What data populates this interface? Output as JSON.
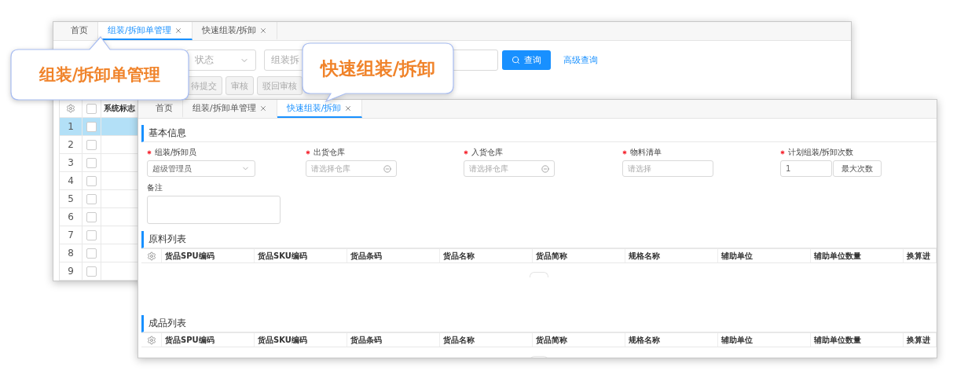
{
  "back_window": {
    "tabs": [
      {
        "label": "首页",
        "closable": false,
        "selected": false
      },
      {
        "label": "组装/拆卸单管理",
        "closable": true,
        "selected": true
      },
      {
        "label": "快速组装/拆卸",
        "closable": true,
        "selected": false
      }
    ],
    "filters": {
      "status_select": {
        "placeholder": "状态"
      },
      "code_input": {
        "placeholder": "组装拆"
      },
      "search_button": "查询",
      "advanced_link": "高级查询"
    },
    "actions": [
      {
        "label": "待提交",
        "disabled": true
      },
      {
        "label": "审核",
        "disabled": true
      },
      {
        "label": "驳回审核",
        "disabled": true
      }
    ],
    "table": {
      "columns": [
        "系统标志"
      ],
      "header_checked": false,
      "rows": [
        {
          "index": "1",
          "selected": true,
          "checked": false
        },
        {
          "index": "2",
          "selected": false,
          "checked": false
        },
        {
          "index": "3",
          "selected": false,
          "checked": false
        },
        {
          "index": "4",
          "selected": false,
          "checked": false
        },
        {
          "index": "5",
          "selected": false,
          "checked": false
        },
        {
          "index": "6",
          "selected": false,
          "checked": false
        },
        {
          "index": "7",
          "selected": false,
          "checked": false
        },
        {
          "index": "8",
          "selected": false,
          "checked": false
        },
        {
          "index": "9",
          "selected": false,
          "checked": false
        }
      ]
    }
  },
  "front_window": {
    "tabs": [
      {
        "label": "首页",
        "closable": false,
        "selected": false
      },
      {
        "label": "组装/拆卸单管理",
        "closable": true,
        "selected": false
      },
      {
        "label": "快速组装/拆卸",
        "closable": true,
        "selected": true
      }
    ],
    "basic_info": {
      "title": "基本信息",
      "fields": [
        {
          "label": "组装/拆卸员",
          "required": true,
          "kind": "select",
          "value": "超级管理员"
        },
        {
          "label": "出货仓库",
          "required": true,
          "kind": "picker",
          "placeholder": "请选择仓库"
        },
        {
          "label": "入货仓库",
          "required": true,
          "kind": "picker",
          "placeholder": "请选择仓库"
        },
        {
          "label": "物料清单",
          "required": true,
          "kind": "input",
          "placeholder": "请选择"
        },
        {
          "label": "计划组装/拆卸次数",
          "required": true,
          "kind": "number",
          "value": "1",
          "button": "最大次数"
        }
      ],
      "remarks": {
        "label": "备注"
      }
    },
    "tables": [
      {
        "title": "原料列表",
        "columns": [
          "货品SPU编码",
          "货品SKU编码",
          "货品条码",
          "货品名称",
          "货品简称",
          "规格名称",
          "辅助单位",
          "辅助单位数量",
          "换算进"
        ]
      },
      {
        "title": "成品列表",
        "columns": [
          "货品SPU编码",
          "货品SKU编码",
          "货品条码",
          "货品名称",
          "货品简称",
          "规格名称",
          "辅助单位",
          "辅助单位数量",
          "换算进"
        ]
      }
    ]
  },
  "callouts": [
    {
      "text": "组装/拆卸单管理",
      "kind": "up"
    },
    {
      "text": "快速组装/拆卸",
      "kind": "down"
    }
  ]
}
